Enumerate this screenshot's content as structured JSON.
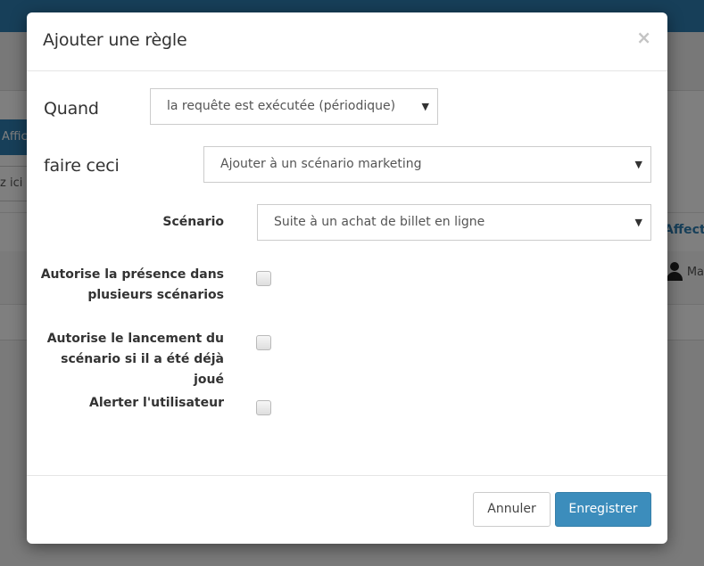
{
  "background": {
    "button_label": "Affich",
    "input_text": "z ici p",
    "column_header": "Affecté",
    "user_label": "Ma"
  },
  "modal": {
    "title": "Ajouter une règle",
    "close_label": "×",
    "when_label": "Quand",
    "when_value": "la requête est exécutée (périodique)",
    "do_label": "faire ceci",
    "do_value": "Ajouter à un scénario marketing",
    "scenario_label": "Scénario",
    "scenario_value": "Suite à un achat de billet en ligne",
    "checkboxes": [
      {
        "label_line1": "Autorise la présence dans",
        "label_line2": "plusieurs scénarios",
        "checked": false
      },
      {
        "label_line1": "Autorise le lancement du",
        "label_line2": "scénario si il a été déjà joué",
        "checked": false
      },
      {
        "label_line1": "Alerter l'utilisateur",
        "label_line2": "",
        "checked": false
      }
    ],
    "cancel_label": "Annuler",
    "save_label": "Enregistrer"
  },
  "colors": {
    "primary": "#3c8dbc",
    "topbar": "#2f7fb3"
  },
  "icons": {
    "caret": "▼"
  }
}
